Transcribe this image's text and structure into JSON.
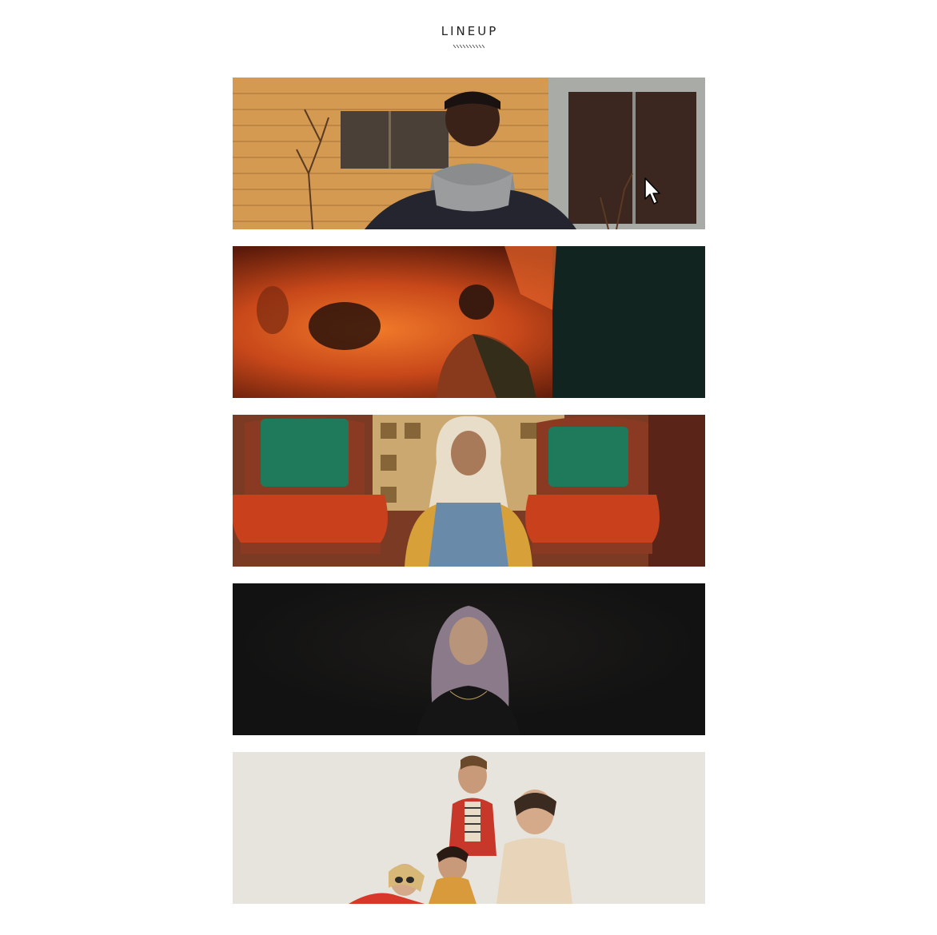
{
  "page": {
    "title": "LINEUP",
    "background": "#ffffff",
    "title_color": "#222222"
  },
  "lineup": [
    {
      "image": "artist-photo-man-grey-hoodie-yellow-house",
      "palette": [
        "#d8a25a",
        "#3a3a3a",
        "#7d7d7d"
      ]
    },
    {
      "image": "artist-photo-shirtless-orange-smoke",
      "palette": [
        "#d8561c",
        "#1a2a22",
        "#6a2410"
      ]
    },
    {
      "image": "artist-photo-woman-blonde-red-armchairs",
      "palette": [
        "#c9431f",
        "#1c7a5a",
        "#d7c7a8"
      ]
    },
    {
      "image": "artist-photo-woman-lavender-hair-dark",
      "palette": [
        "#121212",
        "#8a7a8a",
        "#2a2a2a"
      ]
    },
    {
      "image": "artist-photo-band-four-members-white-wall",
      "palette": [
        "#e6e4dc",
        "#c0392b",
        "#3a2a22"
      ]
    }
  ],
  "cursor": {
    "icon": "mouse-pointer-icon"
  }
}
